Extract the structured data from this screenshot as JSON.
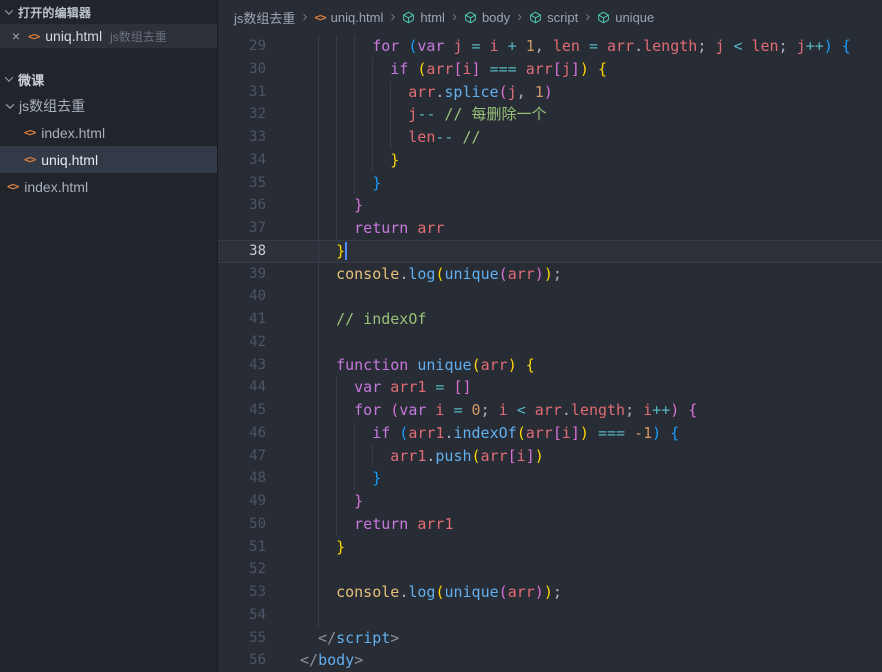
{
  "colors": {
    "kw": "#c678dd",
    "v": "#e06c75",
    "fn": "#61afef",
    "obj": "#e5c07b",
    "num": "#d19a66",
    "cm": "#98c379",
    "op": "#56b6c2",
    "pn": "#abb2bf",
    "b1": "#ffd700",
    "b2": "#da70d6",
    "b3": "#179fff",
    "tag": "#61afef",
    "tp": "#8b929e",
    "htmlicon": "#e0823d",
    "symbolicon": "#4ec9b0"
  },
  "sidebar": {
    "open_editors_label": "打开的编辑器",
    "open_editor": {
      "close": "×",
      "file": "uniq.html",
      "folder": "js数组去重"
    },
    "workspace_label": "微课",
    "tree": [
      {
        "type": "folder",
        "label": "js数组去重",
        "indent": 1,
        "expanded": true
      },
      {
        "type": "file",
        "label": "index.html",
        "indent": 2
      },
      {
        "type": "file",
        "label": "uniq.html",
        "indent": 2,
        "selected": true
      },
      {
        "type": "file",
        "label": "index.html",
        "indent": 1
      }
    ]
  },
  "breadcrumb": {
    "separator": "›",
    "items": [
      {
        "label": "js数组去重",
        "icon": "none"
      },
      {
        "label": "uniq.html",
        "icon": "html"
      },
      {
        "label": "html",
        "icon": "symbol"
      },
      {
        "label": "body",
        "icon": "symbol"
      },
      {
        "label": "script",
        "icon": "symbol"
      },
      {
        "label": "unique",
        "icon": "symbol"
      }
    ]
  },
  "editor": {
    "active_line": 38,
    "lines": [
      {
        "num": 29,
        "indent": 8,
        "tokens": [
          [
            "kw",
            "for "
          ],
          [
            "b3",
            "("
          ],
          [
            "kw",
            "var "
          ],
          [
            "v",
            "j "
          ],
          [
            "op",
            "= "
          ],
          [
            "v",
            "i "
          ],
          [
            "op",
            "+ "
          ],
          [
            "num",
            "1"
          ],
          [
            "pn",
            ", "
          ],
          [
            "v",
            "len "
          ],
          [
            "op",
            "= "
          ],
          [
            "v",
            "arr"
          ],
          [
            "pn",
            "."
          ],
          [
            "v",
            "length"
          ],
          [
            "pn",
            "; "
          ],
          [
            "v",
            "j "
          ],
          [
            "op",
            "< "
          ],
          [
            "v",
            "len"
          ],
          [
            "pn",
            "; "
          ],
          [
            "v",
            "j"
          ],
          [
            "op",
            "++"
          ],
          [
            "b3",
            ") {"
          ]
        ]
      },
      {
        "num": 30,
        "indent": 10,
        "tokens": [
          [
            "kw",
            "if "
          ],
          [
            "b1",
            "("
          ],
          [
            "v",
            "arr"
          ],
          [
            "b2",
            "["
          ],
          [
            "v",
            "i"
          ],
          [
            "b2",
            "]"
          ],
          [
            "op",
            " === "
          ],
          [
            "v",
            "arr"
          ],
          [
            "b2",
            "["
          ],
          [
            "v",
            "j"
          ],
          [
            "b2",
            "]"
          ],
          [
            "b1",
            ") {"
          ]
        ]
      },
      {
        "num": 31,
        "indent": 12,
        "tokens": [
          [
            "v",
            "arr"
          ],
          [
            "pn",
            "."
          ],
          [
            "fn",
            "splice"
          ],
          [
            "b2",
            "("
          ],
          [
            "v",
            "j"
          ],
          [
            "pn",
            ", "
          ],
          [
            "num",
            "1"
          ],
          [
            "b2",
            ")"
          ]
        ]
      },
      {
        "num": 32,
        "indent": 12,
        "tokens": [
          [
            "v",
            "j"
          ],
          [
            "op",
            "--"
          ],
          [
            "pn",
            " "
          ],
          [
            "cm",
            "// 每删除一个"
          ]
        ]
      },
      {
        "num": 33,
        "indent": 12,
        "tokens": [
          [
            "v",
            "len"
          ],
          [
            "op",
            "--"
          ],
          [
            "pn",
            " "
          ],
          [
            "cm",
            "//"
          ]
        ]
      },
      {
        "num": 34,
        "indent": 10,
        "tokens": [
          [
            "b1",
            "}"
          ]
        ]
      },
      {
        "num": 35,
        "indent": 8,
        "tokens": [
          [
            "b3",
            "}"
          ]
        ]
      },
      {
        "num": 36,
        "indent": 6,
        "tokens": [
          [
            "b2",
            "}"
          ]
        ]
      },
      {
        "num": 37,
        "indent": 6,
        "tokens": [
          [
            "kw",
            "return "
          ],
          [
            "v",
            "arr"
          ]
        ]
      },
      {
        "num": 38,
        "indent": 4,
        "tokens": [
          [
            "b1",
            "}"
          ]
        ],
        "cursor": true
      },
      {
        "num": 39,
        "indent": 4,
        "tokens": [
          [
            "obj",
            "console"
          ],
          [
            "pn",
            "."
          ],
          [
            "fn",
            "log"
          ],
          [
            "b1",
            "("
          ],
          [
            "fn",
            "unique"
          ],
          [
            "b2",
            "("
          ],
          [
            "v",
            "arr"
          ],
          [
            "b2",
            ")"
          ],
          [
            "b1",
            ")"
          ],
          [
            "pn",
            ";"
          ]
        ]
      },
      {
        "num": 40,
        "indent": 4,
        "tokens": []
      },
      {
        "num": 41,
        "indent": 4,
        "tokens": [
          [
            "cm",
            "// indexOf"
          ]
        ]
      },
      {
        "num": 42,
        "indent": 4,
        "tokens": []
      },
      {
        "num": 43,
        "indent": 4,
        "tokens": [
          [
            "kw",
            "function "
          ],
          [
            "fn",
            "unique"
          ],
          [
            "b1",
            "("
          ],
          [
            "v",
            "arr"
          ],
          [
            "b1",
            ") {"
          ]
        ]
      },
      {
        "num": 44,
        "indent": 6,
        "tokens": [
          [
            "kw",
            "var "
          ],
          [
            "v",
            "arr1"
          ],
          [
            "op",
            " = "
          ],
          [
            "b2",
            "[]"
          ]
        ]
      },
      {
        "num": 45,
        "indent": 6,
        "tokens": [
          [
            "kw",
            "for "
          ],
          [
            "b2",
            "("
          ],
          [
            "kw",
            "var "
          ],
          [
            "v",
            "i "
          ],
          [
            "op",
            "= "
          ],
          [
            "num",
            "0"
          ],
          [
            "pn",
            "; "
          ],
          [
            "v",
            "i "
          ],
          [
            "op",
            "< "
          ],
          [
            "v",
            "arr"
          ],
          [
            "pn",
            "."
          ],
          [
            "v",
            "length"
          ],
          [
            "pn",
            "; "
          ],
          [
            "v",
            "i"
          ],
          [
            "op",
            "++"
          ],
          [
            "b2",
            ") {"
          ]
        ]
      },
      {
        "num": 46,
        "indent": 8,
        "tokens": [
          [
            "kw",
            "if "
          ],
          [
            "b3",
            "("
          ],
          [
            "v",
            "arr1"
          ],
          [
            "pn",
            "."
          ],
          [
            "fn",
            "indexOf"
          ],
          [
            "b1",
            "("
          ],
          [
            "v",
            "arr"
          ],
          [
            "b2",
            "["
          ],
          [
            "v",
            "i"
          ],
          [
            "b2",
            "]"
          ],
          [
            "b1",
            ")"
          ],
          [
            "op",
            " === "
          ],
          [
            "num",
            "-1"
          ],
          [
            "b3",
            ") {"
          ]
        ]
      },
      {
        "num": 47,
        "indent": 10,
        "tokens": [
          [
            "v",
            "arr1"
          ],
          [
            "pn",
            "."
          ],
          [
            "fn",
            "push"
          ],
          [
            "b1",
            "("
          ],
          [
            "v",
            "arr"
          ],
          [
            "b2",
            "["
          ],
          [
            "v",
            "i"
          ],
          [
            "b2",
            "]"
          ],
          [
            "b1",
            ")"
          ]
        ]
      },
      {
        "num": 48,
        "indent": 8,
        "tokens": [
          [
            "b3",
            "}"
          ]
        ]
      },
      {
        "num": 49,
        "indent": 6,
        "tokens": [
          [
            "b2",
            "}"
          ]
        ]
      },
      {
        "num": 50,
        "indent": 6,
        "tokens": [
          [
            "kw",
            "return "
          ],
          [
            "v",
            "arr1"
          ]
        ]
      },
      {
        "num": 51,
        "indent": 4,
        "tokens": [
          [
            "b1",
            "}"
          ]
        ]
      },
      {
        "num": 52,
        "indent": 4,
        "tokens": []
      },
      {
        "num": 53,
        "indent": 4,
        "tokens": [
          [
            "obj",
            "console"
          ],
          [
            "pn",
            "."
          ],
          [
            "fn",
            "log"
          ],
          [
            "b1",
            "("
          ],
          [
            "fn",
            "unique"
          ],
          [
            "b2",
            "("
          ],
          [
            "v",
            "arr"
          ],
          [
            "b2",
            ")"
          ],
          [
            "b1",
            ")"
          ],
          [
            "pn",
            ";"
          ]
        ]
      },
      {
        "num": 54,
        "indent": 4,
        "tokens": []
      },
      {
        "num": 55,
        "indent": 2,
        "tokens": [
          [
            "tp",
            "</"
          ],
          [
            "tag",
            "script"
          ],
          [
            "tp",
            ">"
          ]
        ]
      },
      {
        "num": 56,
        "indent": 0,
        "tokens": [
          [
            "tp",
            "</"
          ],
          [
            "tag",
            "body"
          ],
          [
            "tp",
            ">"
          ]
        ]
      }
    ]
  }
}
